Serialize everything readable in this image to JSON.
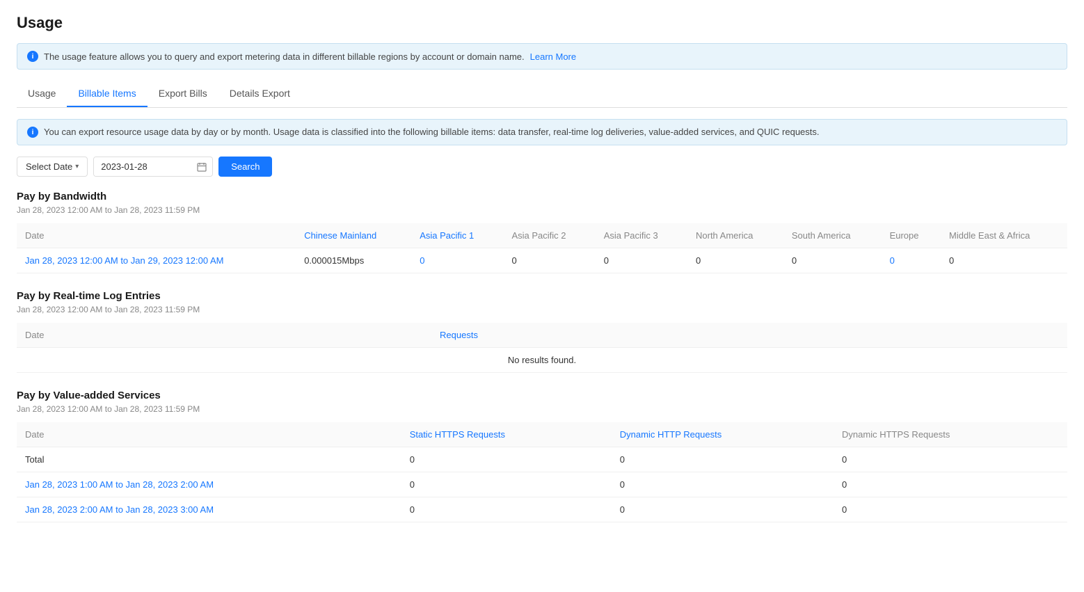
{
  "page": {
    "title": "Usage"
  },
  "top_banner": {
    "text": "The usage feature allows you to query and export metering data in different billable regions by account or domain name.",
    "link_label": "Learn More",
    "icon": "i"
  },
  "tabs": [
    {
      "id": "usage",
      "label": "Usage",
      "active": false
    },
    {
      "id": "billable-items",
      "label": "Billable Items",
      "active": true
    },
    {
      "id": "export-bills",
      "label": "Export Bills",
      "active": false
    },
    {
      "id": "details-export",
      "label": "Details Export",
      "active": false
    }
  ],
  "info_banner2": {
    "text": "You can export resource usage data by day or by month. Usage data is classified into the following billable items: data transfer, real-time log deliveries, value-added services, and QUIC requests.",
    "icon": "i"
  },
  "controls": {
    "select_date_label": "Select Date",
    "date_value": "2023-01-28",
    "search_label": "Search"
  },
  "sections": {
    "bandwidth": {
      "title": "Pay by Bandwidth",
      "date_range": "Jan 28, 2023 12:00 AM to Jan 28, 2023 11:59 PM",
      "columns": [
        {
          "id": "date",
          "label": "Date",
          "is_link": false
        },
        {
          "id": "chinese_mainland",
          "label": "Chinese Mainland",
          "is_link": true
        },
        {
          "id": "asia_pacific_1",
          "label": "Asia Pacific 1",
          "is_link": true
        },
        {
          "id": "asia_pacific_2",
          "label": "Asia Pacific 2",
          "is_link": false
        },
        {
          "id": "asia_pacific_3",
          "label": "Asia Pacific 3",
          "is_link": false
        },
        {
          "id": "north_america",
          "label": "North America",
          "is_link": false
        },
        {
          "id": "south_america",
          "label": "South America",
          "is_link": false
        },
        {
          "id": "europe",
          "label": "Europe",
          "is_link": false
        },
        {
          "id": "middle_east_africa",
          "label": "Middle East & Africa",
          "is_link": false
        }
      ],
      "rows": [
        {
          "date": "Jan 28, 2023 12:00 AM to Jan 29, 2023 12:00 AM",
          "date_is_link": true,
          "chinese_mainland": "0.000015Mbps",
          "chinese_mainland_is_link": false,
          "asia_pacific_1": "0",
          "asia_pacific_1_is_link": true,
          "asia_pacific_2": "0",
          "asia_pacific_2_is_link": false,
          "asia_pacific_3": "0",
          "asia_pacific_3_is_link": false,
          "north_america": "0",
          "north_america_is_link": false,
          "south_america": "0",
          "south_america_is_link": false,
          "europe": "0",
          "europe_is_link": true,
          "middle_east_africa": "0",
          "middle_east_africa_is_link": false
        }
      ]
    },
    "realtime_log": {
      "title": "Pay by Real-time Log Entries",
      "date_range": "Jan 28, 2023 12:00 AM to Jan 28, 2023 11:59 PM",
      "columns": [
        {
          "id": "date",
          "label": "Date"
        },
        {
          "id": "requests",
          "label": "Requests",
          "is_link": true
        }
      ],
      "no_results": "No results found."
    },
    "value_added": {
      "title": "Pay by Value-added Services",
      "date_range": "Jan 28, 2023 12:00 AM to Jan 28, 2023 11:59 PM",
      "columns": [
        {
          "id": "date",
          "label": "Date"
        },
        {
          "id": "static_https",
          "label": "Static HTTPS Requests",
          "is_link": true
        },
        {
          "id": "dynamic_http",
          "label": "Dynamic HTTP Requests",
          "is_link": true
        },
        {
          "id": "dynamic_https",
          "label": "Dynamic HTTPS Requests",
          "is_link": false
        }
      ],
      "rows": [
        {
          "date": "Total",
          "date_is_link": false,
          "static_https": "0",
          "dynamic_http": "0",
          "dynamic_https": "0"
        },
        {
          "date": "Jan 28, 2023 1:00 AM to Jan 28, 2023 2:00 AM",
          "date_is_link": true,
          "static_https": "0",
          "dynamic_http": "0",
          "dynamic_https": "0"
        },
        {
          "date": "Jan 28, 2023 2:00 AM to Jan 28, 2023 3:00 AM",
          "date_is_link": true,
          "static_https": "0",
          "dynamic_http": "0",
          "dynamic_https": "0"
        }
      ]
    }
  }
}
